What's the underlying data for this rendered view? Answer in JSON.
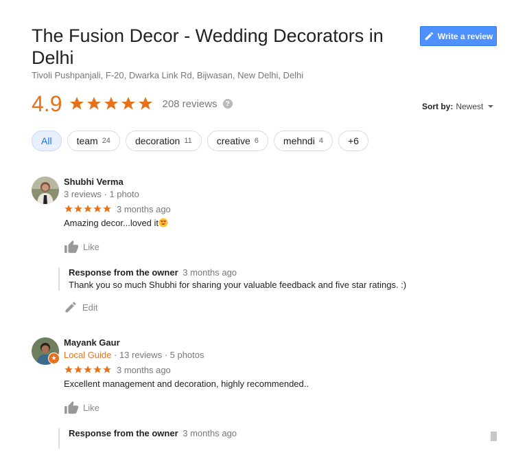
{
  "business": {
    "title": "The Fusion Decor - Wedding Decorators in Delhi",
    "address": "Tivoli Pushpanjali, F-20, Dwarka Link Rd, Bijwasan, New Delhi, Delhi",
    "rating": "4.9",
    "stars": 5,
    "reviews_label": "208 reviews",
    "help_icon": "?"
  },
  "write_review": {
    "label": "Write a review",
    "icon": "pencil-icon"
  },
  "sort": {
    "label": "Sort by:",
    "value": "Newest"
  },
  "chips": [
    {
      "label": "All",
      "count": "",
      "active": true
    },
    {
      "label": "team",
      "count": "24"
    },
    {
      "label": "decoration",
      "count": "11"
    },
    {
      "label": "creative",
      "count": "6"
    },
    {
      "label": "mehndi",
      "count": "4"
    },
    {
      "label": "+6",
      "count": ""
    }
  ],
  "reviews": [
    {
      "name": "Shubhi Verma",
      "meta": "3 reviews · 1 photo",
      "stars": 5,
      "time": "3 months ago",
      "text": "Amazing decor...loved it",
      "like_label": "Like",
      "response": {
        "owner_label": "Response from the owner",
        "time": "3 months ago",
        "text": "Thank you so much Shubhi for sharing your valuable feedback and five star ratings. :)",
        "edit_label": "Edit"
      }
    },
    {
      "name": "Mayank Gaur",
      "guide_label": "Local Guide",
      "meta": " · 13 reviews · 5 photos",
      "stars": 5,
      "time": "3 months ago",
      "text": "Excellent management and decoration, highly recommended..",
      "like_label": "Like",
      "response": {
        "owner_label": "Response from the owner",
        "time": "3 months ago"
      }
    }
  ],
  "colors": {
    "accent": "#e7711b",
    "button": "#4d90fe",
    "chip_active": "#e8f0fe"
  }
}
